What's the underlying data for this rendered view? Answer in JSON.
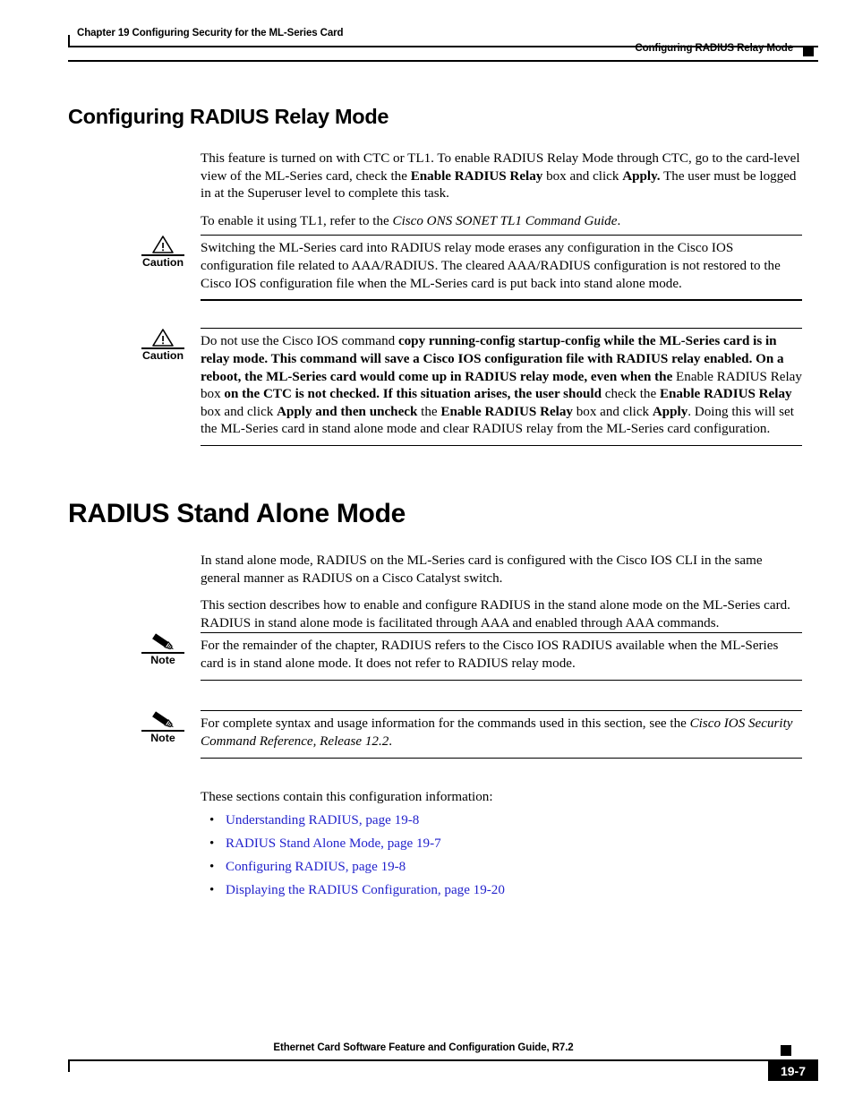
{
  "header": {
    "chapter": "Chapter 19      Configuring Security for the ML-Series Card",
    "section": "Configuring RADIUS Relay Mode"
  },
  "headings": {
    "relay_mode": "Configuring RADIUS Relay Mode",
    "stand_alone": "RADIUS Stand Alone Mode"
  },
  "relay_section": {
    "para1_a": "This feature is turned on with CTC or TL1. To enable RADIUS Relay Mode through CTC, go to the card-level view of the ML-Series card, check the ",
    "para1_b": "Enable RADIUS Relay",
    "para1_c": " box and click ",
    "para1_d": "Apply.",
    "para1_e": " The user must be logged in at the Superuser level to complete this task.",
    "para2_a": "To enable it using TL1, refer to the ",
    "para2_b": "Cisco ONS SONET TL1 Command Guide",
    "para2_c": "."
  },
  "caution1": {
    "label": "Caution",
    "icon": "warning-triangle-icon",
    "text": "Switching the ML-Series card into RADIUS relay mode erases any configuration in the Cisco IOS configuration file related to AAA/RADIUS. The cleared AAA/RADIUS configuration is not restored to the Cisco IOS configuration file when the ML-Series card is put back into stand alone mode."
  },
  "caution2": {
    "label": "Caution",
    "icon": "warning-triangle-icon",
    "seg1": "Do not use the Cisco IOS command ",
    "seg2": "copy running-config startup-config while the ML-Series card is in relay mode. This command will save a Cisco IOS configuration file with RADIUS relay enabled. On a reboot, the ML-Series card would come up in RADIUS relay mode, even when the",
    "seg3": " Enable RADIUS Relay box ",
    "seg4": "on the CTC is not checked. If this situation arises, the user should",
    "seg5": " check the ",
    "seg6": "Enable RADIUS Relay",
    "seg7": " box and click ",
    "seg8": "Apply and then uncheck",
    "seg9": " the ",
    "seg10": "Enable RADIUS Relay",
    "seg11": " box and click ",
    "seg12": "Apply",
    "seg13": ". Doing this will set the ML-Series card in stand alone mode and clear RADIUS relay from the ML-Series card configuration."
  },
  "stand_alone_section": {
    "para1": "In stand alone mode, RADIUS on the ML-Series card is configured with the Cisco IOS CLI in the same general manner as RADIUS on a Cisco Catalyst switch.",
    "para2": "This section describes how to enable and configure RADIUS in the stand alone mode on the ML-Series card. RADIUS in stand alone mode is facilitated through AAA and enabled through AAA commands."
  },
  "note1": {
    "label": "Note",
    "icon": "pencil-icon",
    "text": "For the remainder of the chapter, RADIUS refers to the Cisco IOS RADIUS available when the ML-Series card is in stand alone mode. It does not refer to RADIUS relay mode."
  },
  "note2": {
    "label": "Note",
    "icon": "pencil-icon",
    "text_a": "For complete syntax and usage information for the commands used in this section, see the ",
    "text_b": "Cisco IOS Security Command Reference, Release 12.2",
    "text_c": "."
  },
  "sections_intro": "These sections contain this configuration information:",
  "link_list": [
    {
      "bullet": "•",
      "label": "Understanding RADIUS, page 19-8"
    },
    {
      "bullet": "•",
      "label": "RADIUS Stand Alone Mode, page 19-7"
    },
    {
      "bullet": "•",
      "label": "Configuring RADIUS, page 19-8"
    },
    {
      "bullet": "•",
      "label": "Displaying the RADIUS Configuration, page 19-20"
    }
  ],
  "footer": {
    "title": "Ethernet Card Software Feature and Configuration Guide, R7.2",
    "page_number": "19-7"
  },
  "colors": {
    "link": "#2222cc",
    "rule": "#000000",
    "page_box": "#000000"
  }
}
